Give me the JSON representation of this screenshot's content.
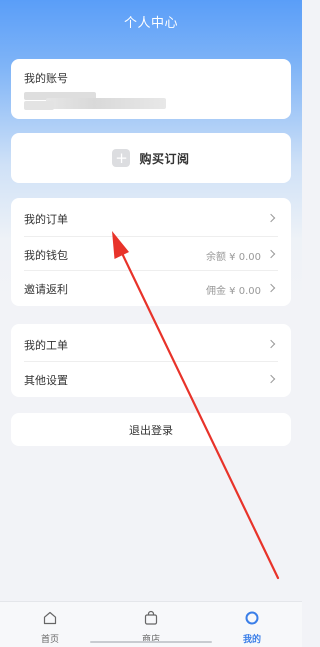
{
  "header": {
    "title": "个人中心"
  },
  "account": {
    "label": "我的账号",
    "value": ""
  },
  "subscription": {
    "buy_icon": "plus-icon",
    "buy_label": "购买订阅"
  },
  "menu1": [
    {
      "label": "我的订单",
      "value": ""
    },
    {
      "label": "我的钱包",
      "value": "余额 ¥ 0.00"
    },
    {
      "label": "邀请返利",
      "value": "佣金 ¥ 0.00"
    }
  ],
  "menu2": [
    {
      "label": "我的工单"
    },
    {
      "label": "其他设置"
    }
  ],
  "logout": {
    "label": "退出登录"
  },
  "tabbar": {
    "items": [
      {
        "label": "首页",
        "icon": "home-icon"
      },
      {
        "label": "商店",
        "icon": "shop-bag-icon"
      },
      {
        "label": "我的",
        "icon": "profile-ring-icon"
      }
    ],
    "active_index": 2
  },
  "colors": {
    "accent": "#3a7ee8",
    "header_top": "#5a9ef8",
    "annotation_arrow": "#e8332a"
  }
}
